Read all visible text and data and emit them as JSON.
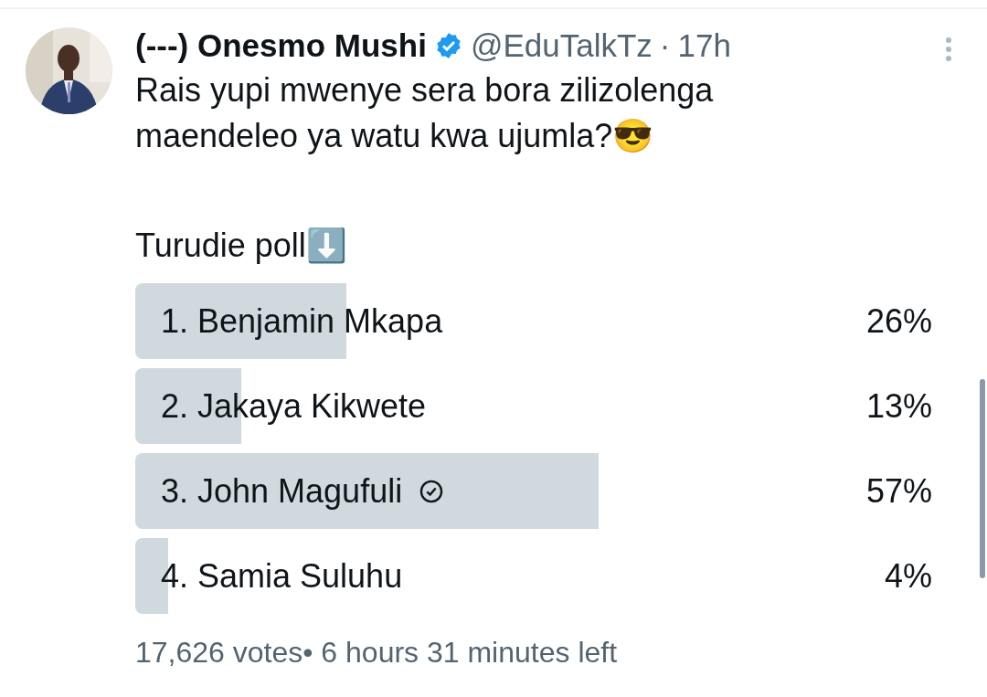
{
  "tweet": {
    "display_name": "(---) Onesmo Mushi",
    "verified": true,
    "handle": "@EduTalkTz",
    "separator": "·",
    "time": "17h",
    "text_lines": [
      "Rais yupi mwenye sera bora zilizolenga",
      "maendeleo ya watu kwa ujumla?😎"
    ],
    "poll_intro": "Turudie poll⬇️"
  },
  "poll": {
    "options": [
      {
        "label": "1. Benjamin Mkapa",
        "percent": "26%",
        "selected": false
      },
      {
        "label": "2. Jakaya Kikwete",
        "percent": "13%",
        "selected": false
      },
      {
        "label": "3. John Magufuli",
        "percent": "57%",
        "selected": true
      },
      {
        "label": "4. Samia Suluhu",
        "percent": "4%",
        "selected": false
      }
    ],
    "votes": "17,626 votes",
    "time_left": "• 6 hours 31 minutes left"
  }
}
